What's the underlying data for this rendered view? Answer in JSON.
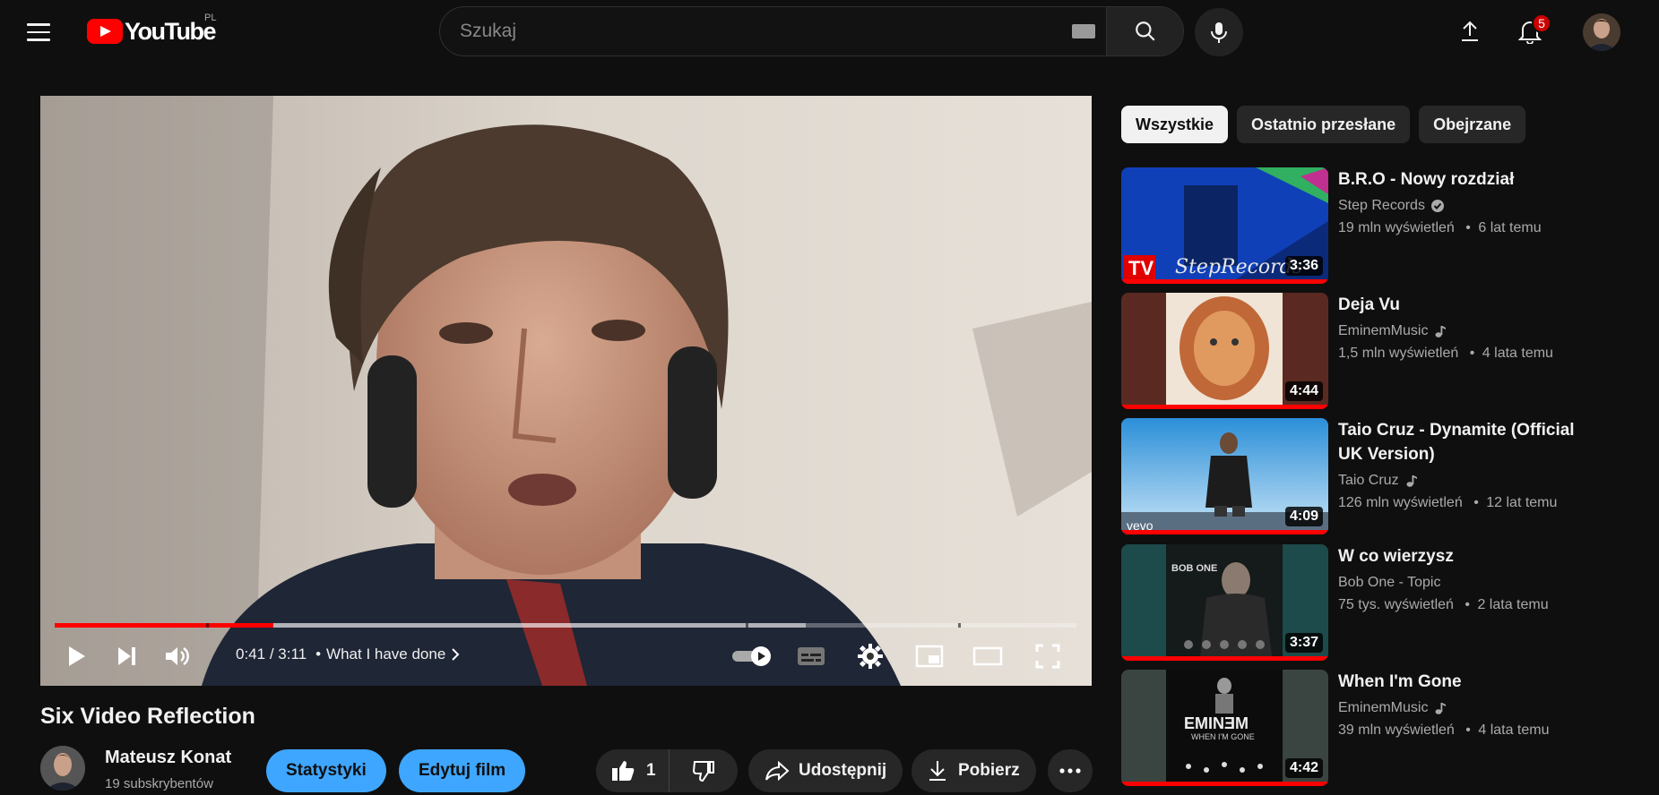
{
  "header": {
    "logo_text": "YouTube",
    "region": "PL",
    "search_placeholder": "Szukaj",
    "notifications_count": "5"
  },
  "player": {
    "current_time": "0:41",
    "separator": " / ",
    "duration": "3:11",
    "chapter_dot": "•",
    "chapter": "What I have done",
    "progress_played_fraction": 0.214,
    "progress_loaded_fraction": 0.735,
    "chapter_marks_fraction": [
      0.148,
      0.676,
      0.884
    ]
  },
  "video": {
    "title": "Six Video Reflection",
    "channel": "Mateusz Konat",
    "subscribers": "19 subskrybentów",
    "stats_button": "Statystyki",
    "edit_button": "Edytuj film",
    "likes": "1",
    "share_label": "Udostępnij",
    "download_label": "Pobierz"
  },
  "sidebar": {
    "chips": [
      "Wszystkie",
      "Ostatnio przesłane",
      "Obejrzane"
    ],
    "active_chip": "Wszystkie",
    "recommendations": [
      {
        "title": "B.R.O - Nowy rozdział",
        "channel": "Step Records",
        "channel_badge": "verified-icon",
        "views": "19 mln wyświetleń",
        "age": "6 lat temu",
        "duration": "3:36"
      },
      {
        "title": "Deja Vu",
        "channel": "EminemMusic",
        "channel_badge": "music-note-icon",
        "views": "1,5 mln wyświetleń",
        "age": "4 lata temu",
        "duration": "4:44"
      },
      {
        "title": "Taio Cruz - Dynamite (Official UK Version)",
        "channel": "Taio Cruz",
        "channel_badge": "music-note-icon",
        "views": "126 mln wyświetleń",
        "age": "12 lat temu",
        "duration": "4:09"
      },
      {
        "title": "W co wierzysz",
        "channel": "Bob One - Topic",
        "channel_badge": "",
        "views": "75 tys. wyświetleń",
        "age": "2 lata temu",
        "duration": "3:37"
      },
      {
        "title": "When I'm Gone",
        "channel": "EminemMusic",
        "channel_badge": "music-note-icon",
        "views": "39 mln wyświetleń",
        "age": "4 lata temu",
        "duration": "4:42"
      }
    ],
    "meta_dot": "•"
  },
  "thumb_texts": {
    "tv": "TV",
    "step_records": "StepRecords",
    "vevo": "vevo",
    "bob_one": "BOB ONE",
    "eminem": "EMINƎM",
    "when_im_gone": "WHEN I'M GONE"
  },
  "colors": {
    "background": "#0f0f0f",
    "accent_red": "#ff0000",
    "button_blue": "#3ea6ff",
    "chip_bg": "#272727"
  }
}
